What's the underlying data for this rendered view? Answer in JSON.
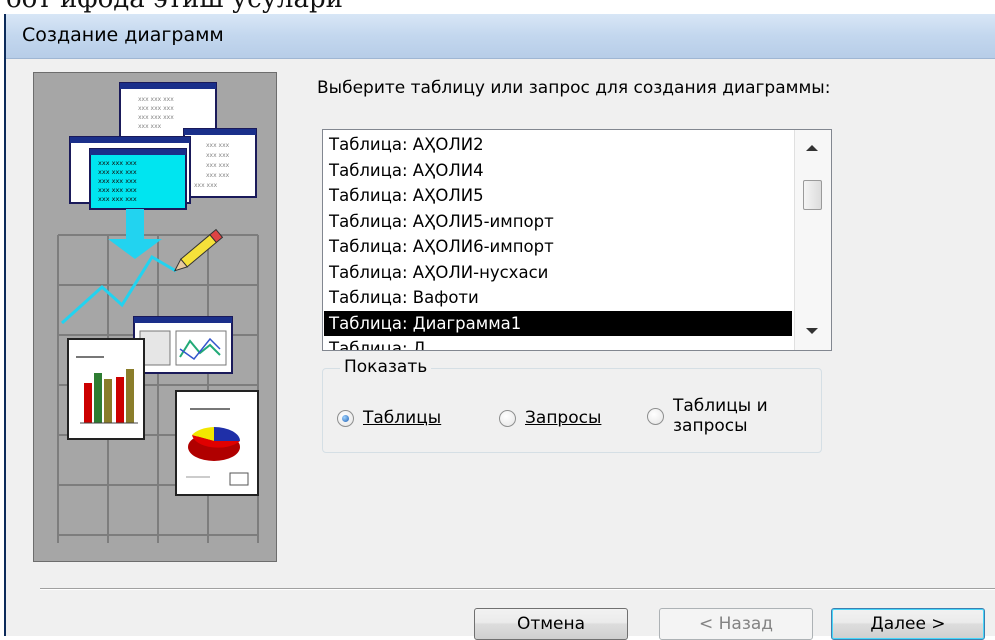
{
  "dialog": {
    "title": "Создание диаграмм",
    "prompt": "Выберите таблицу или запрос для создания диаграммы:",
    "list": {
      "items": [
        "Таблица: АҲОЛИ2",
        "Таблица: АҲОЛИ4",
        "Таблица: АҲОЛИ5",
        "Таблица: АҲОЛИ5-импорт",
        "Таблица: АҲОЛИ6-импорт",
        "Таблица: АҲОЛИ-нусхаси",
        "Таблица: Вафоти",
        "Таблица: Диаграмма1",
        "Таблица: Д"
      ],
      "selected_index": 7
    },
    "show_group": {
      "label": "Показать",
      "options": [
        {
          "label": "Таблицы",
          "checked": true
        },
        {
          "label": "Запросы",
          "checked": false
        },
        {
          "label_line1": "Таблицы и",
          "label_line2": "запросы",
          "checked": false
        }
      ]
    },
    "buttons": {
      "cancel": "Отмена",
      "back": "< Назад",
      "next": "Далее >"
    }
  },
  "illustration": {
    "sheet_cell_text": "xxx",
    "colors": {
      "panel_bg": "#a6a6a6",
      "highlight_table": "#00e5f0",
      "arrow": "#22d3f0",
      "bar_red": "#cc0000",
      "bar_green": "#2e7d32",
      "bar_olive": "#8a7d2a",
      "pie_red": "#e00000",
      "pie_blue": "#1f2fa8",
      "pie_yellow": "#f2e600"
    }
  },
  "icons": {
    "scroll_up": "chevron-up-icon",
    "scroll_down": "chevron-down-icon",
    "pencil": "pencil-icon",
    "illustration_arrow": "arrow-down-icon",
    "bar_chart": "bar-chart-icon",
    "pie_chart": "pie-chart-icon"
  }
}
